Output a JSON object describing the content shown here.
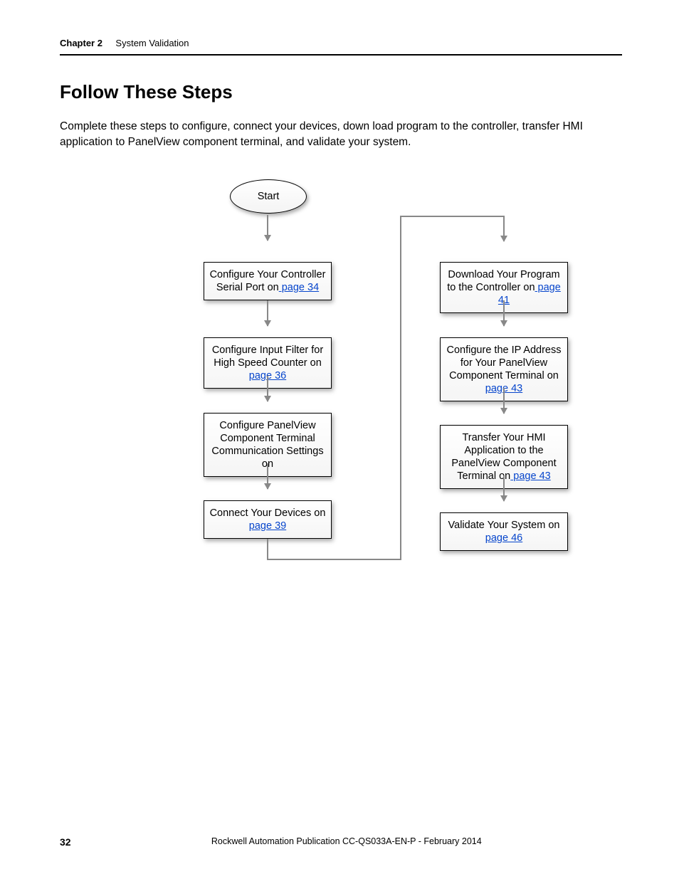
{
  "header": {
    "chapter_label": "Chapter 2",
    "chapter_title": "System Validation"
  },
  "section_title": "Follow These Steps",
  "intro_text": "Complete these steps to configure, connect your devices, down load program to the controller, transfer HMI application to PanelView component terminal, and validate your system.",
  "flow": {
    "start": "Start",
    "left": [
      {
        "text_pre": "Configure Your Controller Serial Port on",
        "link": " page 34"
      },
      {
        "text_pre": "Configure Input Filter for High Speed Counter on",
        "link": " page 36"
      },
      {
        "text_pre": "Configure PanelView Component Terminal Communication Settings on",
        "link": " "
      },
      {
        "text_pre": "Connect Your Devices on",
        "link": " page 39"
      }
    ],
    "right": [
      {
        "text_pre": "Download Your Program to the Controller on",
        "link": " page 41"
      },
      {
        "text_pre": "Configure the IP Address for Your PanelView Component Terminal on",
        "link": " page 43"
      },
      {
        "text_pre": "Transfer Your HMI Application to the PanelView Component Terminal on",
        "link": " page 43"
      },
      {
        "text_pre": "Validate Your System on",
        "link": " page 46"
      }
    ]
  },
  "footer": {
    "page": "32",
    "publication": "Rockwell Automation Publication CC-QS033A-EN-P - February 2014"
  }
}
